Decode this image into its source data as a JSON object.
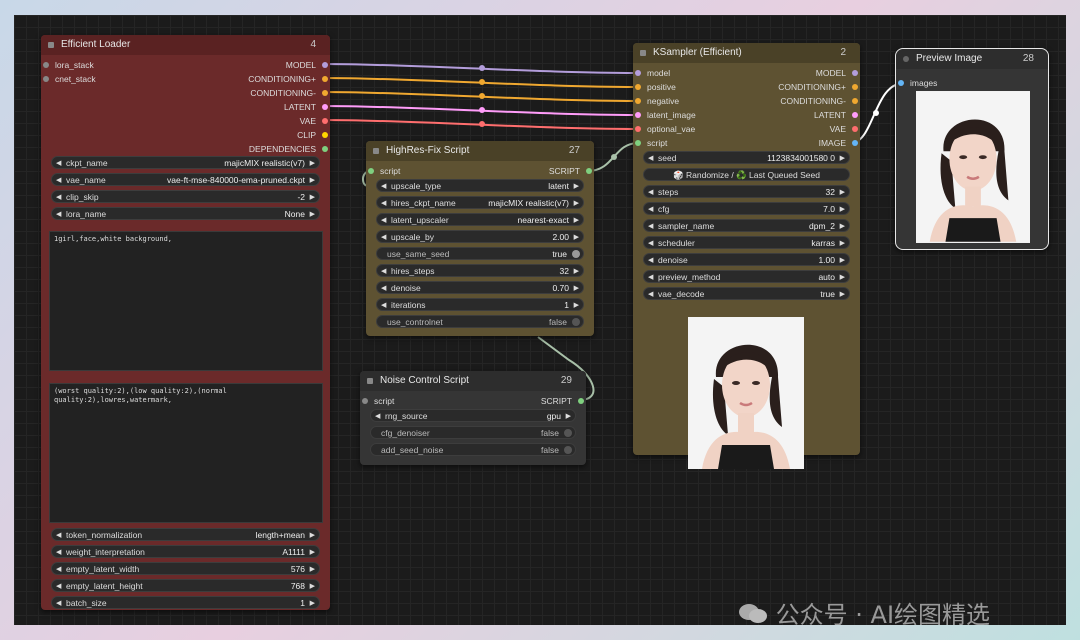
{
  "efficient_loader": {
    "title": "Efficient Loader",
    "id": "4",
    "inputs": [
      "lora_stack",
      "cnet_stack"
    ],
    "outputs": [
      "MODEL",
      "CONDITIONING+",
      "CONDITIONING-",
      "LATENT",
      "VAE",
      "CLIP",
      "DEPENDENCIES"
    ],
    "widgets": [
      {
        "label": "ckpt_name",
        "value": "majicMIX realistic(v7)"
      },
      {
        "label": "vae_name",
        "value": "vae-ft-mse-840000-ema-pruned.ckpt"
      },
      {
        "label": "clip_skip",
        "value": "-2"
      },
      {
        "label": "lora_name",
        "value": "None"
      }
    ],
    "positive_prompt": "1girl,face,white background,",
    "negative_prompt": "(worst quality:2),(low quality:2),(normal\nquality:2),lowres,watermark,",
    "widgets2": [
      {
        "label": "token_normalization",
        "value": "length+mean"
      },
      {
        "label": "weight_interpretation",
        "value": "A1111"
      },
      {
        "label": "empty_latent_width",
        "value": "576"
      },
      {
        "label": "empty_latent_height",
        "value": "768"
      },
      {
        "label": "batch_size",
        "value": "1"
      }
    ]
  },
  "hires": {
    "title": "HighRes-Fix Script",
    "id": "27",
    "input": "script",
    "output": "SCRIPT",
    "widgets": [
      {
        "label": "upscale_type",
        "value": "latent"
      },
      {
        "label": "hires_ckpt_name",
        "value": "majicMIX realistic(v7)"
      },
      {
        "label": "latent_upscaler",
        "value": "nearest-exact"
      },
      {
        "label": "upscale_by",
        "value": "2.00"
      },
      {
        "label": "use_same_seed",
        "value": "true"
      },
      {
        "label": "hires_steps",
        "value": "32"
      },
      {
        "label": "denoise",
        "value": "0.70"
      },
      {
        "label": "iterations",
        "value": "1"
      },
      {
        "label": "use_controlnet",
        "value": "false"
      }
    ]
  },
  "noise": {
    "title": "Noise Control Script",
    "id": "29",
    "input": "script",
    "output": "SCRIPT",
    "widgets": [
      {
        "label": "rng_source",
        "value": "gpu"
      },
      {
        "label": "cfg_denoiser",
        "value": "false"
      },
      {
        "label": "add_seed_noise",
        "value": "false"
      }
    ]
  },
  "ksampler": {
    "title": "KSampler (Efficient)",
    "id": "2",
    "inputs": [
      "model",
      "positive",
      "negative",
      "latent_image",
      "optional_vae",
      "script"
    ],
    "outputs": [
      "MODEL",
      "CONDITIONING+",
      "CONDITIONING-",
      "LATENT",
      "VAE",
      "IMAGE"
    ],
    "seed_label": "seed",
    "seed_value": "1123834001580 0",
    "randomize": "🎲 Randomize / ♻️ Last Queued Seed",
    "widgets": [
      {
        "label": "steps",
        "value": "32"
      },
      {
        "label": "cfg",
        "value": "7.0"
      },
      {
        "label": "sampler_name",
        "value": "dpm_2"
      },
      {
        "label": "scheduler",
        "value": "karras"
      },
      {
        "label": "denoise",
        "value": "1.00"
      },
      {
        "label": "preview_method",
        "value": "auto"
      },
      {
        "label": "vae_decode",
        "value": "true"
      }
    ]
  },
  "preview": {
    "title": "Preview Image",
    "id": "28",
    "input": "images"
  },
  "watermark": "公众号 · AI绘图精选",
  "colors": {
    "loader": "#6b2a2a",
    "loader_hdr": "#5a2222",
    "script": "#5e5232",
    "script_hdr": "#4a4127",
    "noise": "#353535",
    "model": "#b39ddb",
    "cond_pos": "#f0a830",
    "cond_neg": "#f0a830",
    "latent": "#ff9cf9",
    "vae": "#ff6e6e",
    "clip": "#ffd500",
    "script_wire": "#a8c0a8",
    "image": "#64b5f6"
  }
}
